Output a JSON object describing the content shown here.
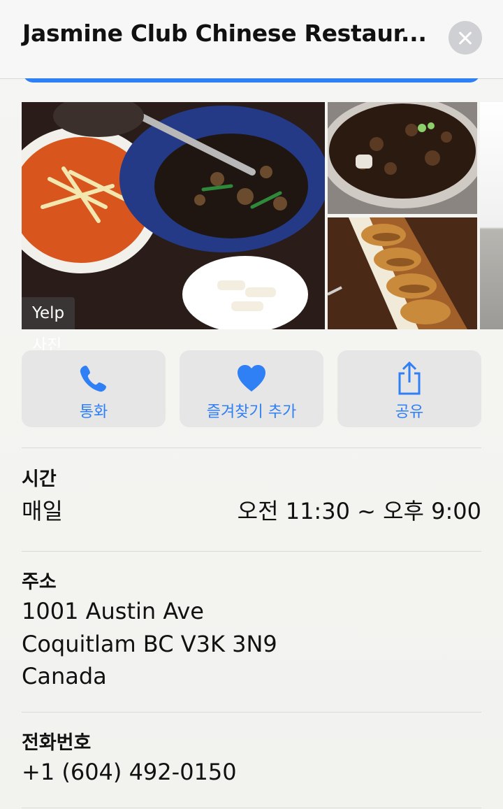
{
  "header": {
    "title": "Jasmine Club Chinese Restaur...",
    "close_icon": "close-icon"
  },
  "photos": {
    "source_label": "Yelp 사진"
  },
  "actions": [
    {
      "label": "통화",
      "icon": "phone-icon"
    },
    {
      "label": "즐겨찾기 추가",
      "icon": "heart-icon"
    },
    {
      "label": "공유",
      "icon": "share-icon"
    }
  ],
  "hours": {
    "heading": "시간",
    "day": "매일",
    "time": "오전 11:30 ~ 오후 9:00"
  },
  "address": {
    "heading": "주소",
    "line1": "1001 Austin Ave",
    "line2": "Coquitlam BC V3K 3N9",
    "line3": "Canada"
  },
  "phone": {
    "heading": "전화번호",
    "number": "+1 (604) 492-0150"
  },
  "colors": {
    "accent": "#2f7ff5",
    "button_bg": "#e6e6e6"
  }
}
